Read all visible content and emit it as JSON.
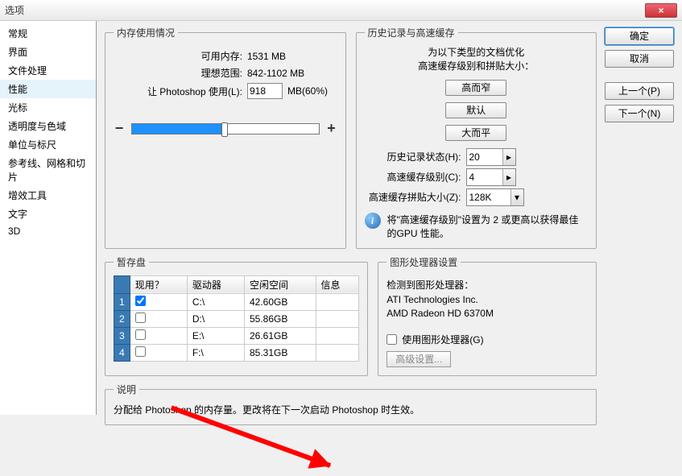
{
  "window": {
    "title": "选项"
  },
  "sidebar": {
    "items": [
      {
        "label": "常规"
      },
      {
        "label": "界面"
      },
      {
        "label": "文件处理"
      },
      {
        "label": "性能",
        "selected": true
      },
      {
        "label": "光标"
      },
      {
        "label": "透明度与色域"
      },
      {
        "label": "单位与标尺"
      },
      {
        "label": "参考线、网格和切片"
      },
      {
        "label": "增效工具"
      },
      {
        "label": "文字"
      },
      {
        "label": "3D"
      }
    ]
  },
  "buttons": {
    "ok": "确定",
    "cancel": "取消",
    "prev": "上一个(P)",
    "next": "下一个(N)"
  },
  "memory": {
    "legend": "内存使用情况",
    "avail_label": "可用内存:",
    "avail_value": "1531 MB",
    "ideal_label": "理想范围:",
    "ideal_value": "842-1102 MB",
    "let_label": "让 Photoshop 使用(L):",
    "let_value": "918",
    "let_unit": "MB(60%)",
    "minus": "−",
    "plus": "+"
  },
  "cache": {
    "legend": "历史记录与高速缓存",
    "optimize": "为以下类型的文档优化\n高速缓存级别和拼贴大小：",
    "btn_tall": "高而窄",
    "btn_default": "默认",
    "btn_wide": "大而平",
    "history_label": "历史记录状态(H):",
    "history_value": "20",
    "levels_label": "高速缓存级别(C):",
    "levels_value": "4",
    "tile_label": "高速缓存拼贴大小(Z):",
    "tile_value": "128K",
    "info": "将\"高速缓存级别\"设置为 2 或更高以获得最佳的GPU 性能。"
  },
  "scratch": {
    "legend": "暂存盘",
    "cols": {
      "active": "现用？",
      "drive": "驱动器",
      "free": "空闲空间",
      "info": "信息"
    },
    "rows": [
      {
        "n": "1",
        "active": true,
        "drive": "C:\\",
        "free": "42.60GB"
      },
      {
        "n": "2",
        "active": false,
        "drive": "D:\\",
        "free": "55.86GB"
      },
      {
        "n": "3",
        "active": false,
        "drive": "E:\\",
        "free": "26.61GB"
      },
      {
        "n": "4",
        "active": false,
        "drive": "F:\\",
        "free": "85.31GB"
      }
    ]
  },
  "gpu": {
    "legend": "图形处理器设置",
    "detected": "检测到图形处理器：",
    "vendor": "ATI Technologies Inc.",
    "model": "AMD Radeon HD 6370M",
    "use_label": "使用图形处理器(G)",
    "adv": "高级设置..."
  },
  "desc": {
    "legend": "说明",
    "text": "分配给 Photoshop 的内存量。更改将在下一次启动 Photoshop 时生效。"
  }
}
